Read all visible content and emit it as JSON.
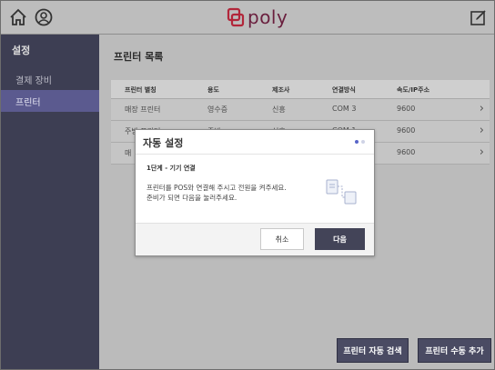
{
  "brand": {
    "logo_text": "poly"
  },
  "topbar": {
    "home_icon": "home-icon",
    "user_icon": "user-circle-icon",
    "edit_icon": "edit-square-icon"
  },
  "sidebar": {
    "title": "설정",
    "items": [
      {
        "label": "결제 장비",
        "active": false
      },
      {
        "label": "프린터",
        "active": true
      }
    ]
  },
  "main": {
    "title": "프린터 목록",
    "columns": [
      "프린터 별칭",
      "용도",
      "제조사",
      "연결방식",
      "속도/IP주소"
    ],
    "rows": [
      {
        "alias": "매장 프린터",
        "purpose": "영수증",
        "maker": "신흥",
        "connection": "COM 3",
        "speed": "9600"
      },
      {
        "alias": "주방 프린터",
        "purpose": "주방",
        "maker": "신흥",
        "connection": "COM 1",
        "speed": "9600"
      },
      {
        "alias": "매",
        "purpose": "",
        "maker": "",
        "connection": "",
        "speed": "9600"
      }
    ],
    "auto_search_label": "프린터 자동 검색",
    "manual_add_label": "프린터 수동 추가"
  },
  "dialog": {
    "title": "자동 설정",
    "step_label": "1단계 - 기기 연결",
    "body_line1": "프린터를 POS와 연결해 주시고 전원을 켜주세요.",
    "body_line2": "준비가 되면 다음을 눌러주세요.",
    "cancel_label": "취소",
    "next_label": "다음",
    "step_count": 2,
    "current_step": 1
  },
  "colors": {
    "sidebar_bg": "#3d3e53",
    "sidebar_active": "#5b5a8f",
    "button_dark": "#4a4b63",
    "brand": "#b2263a",
    "dot_active": "#5865c8",
    "dot_inactive": "#cfd3e6"
  }
}
